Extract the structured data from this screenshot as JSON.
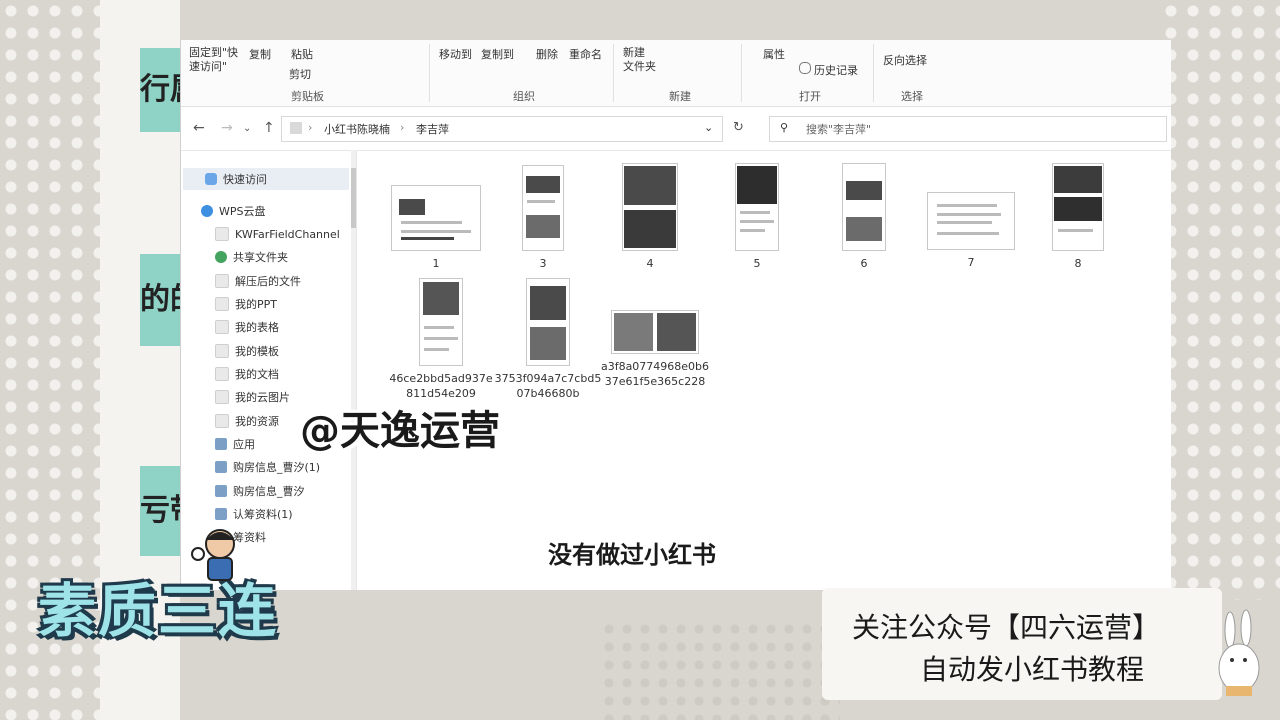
{
  "ribbon": {
    "pin_quick_access": "固定到\"快\n速访问\"",
    "copy": "复制",
    "paste": "粘贴",
    "cut": "剪切",
    "clipboard_group": "剪贴板",
    "move_to": "移动到",
    "copy_to": "复制到",
    "delete": "删除",
    "rename": "重命名",
    "organize_group": "组织",
    "new_folder": "新建\n文件夹",
    "new_group": "新建",
    "properties": "属性",
    "history": "历史记录",
    "open_group": "打开",
    "invert_selection": "反向选择",
    "select_group": "选择"
  },
  "address": {
    "crumb_1": "小红书陈晓楠",
    "crumb_2": "李吉萍",
    "search_placeholder": "搜索\"李吉萍\""
  },
  "sidebar": {
    "items": [
      {
        "label": "快速访问",
        "icon": "star-icon"
      },
      {
        "label": "WPS云盘",
        "icon": "cloud-icon"
      },
      {
        "label": "KWFarFieldChannel",
        "icon": "folder-icon"
      },
      {
        "label": "共享文件夹",
        "icon": "share-icon"
      },
      {
        "label": "解压后的文件",
        "icon": "folder-icon"
      },
      {
        "label": "我的PPT",
        "icon": "folder-icon"
      },
      {
        "label": "我的表格",
        "icon": "folder-icon"
      },
      {
        "label": "我的模板",
        "icon": "folder-icon"
      },
      {
        "label": "我的文档",
        "icon": "folder-icon"
      },
      {
        "label": "我的云图片",
        "icon": "folder-icon"
      },
      {
        "label": "我的资源",
        "icon": "folder-icon"
      },
      {
        "label": "应用",
        "icon": "app-icon"
      },
      {
        "label": "购房信息_曹汐(1)",
        "icon": "app-icon"
      },
      {
        "label": "购房信息_曹汐",
        "icon": "app-icon"
      },
      {
        "label": "认筹资料(1)",
        "icon": "app-icon"
      },
      {
        "label": "筹资料",
        "icon": "app-icon"
      }
    ]
  },
  "files": [
    {
      "name": "1"
    },
    {
      "name": "3"
    },
    {
      "name": "4"
    },
    {
      "name": "5"
    },
    {
      "name": "6"
    },
    {
      "name": "7"
    },
    {
      "name": "8"
    },
    {
      "name": "46ce2bbd5ad937e811d54e209"
    },
    {
      "name": "3753f094a7c7cbd507b46680b"
    },
    {
      "name": "a3f8a0774968e0b637e61f5e365c228"
    }
  ],
  "overlay": {
    "watermark": "@天逸运营",
    "subtitle": "没有做过小红书",
    "promo_line1": "关注公众号【四六运营】",
    "promo_line2": "自动发小红书教程",
    "sticker": "素质三连"
  },
  "background_text": {
    "block_1": "行属",
    "block_2": "的的",
    "block_3": "亏带"
  }
}
